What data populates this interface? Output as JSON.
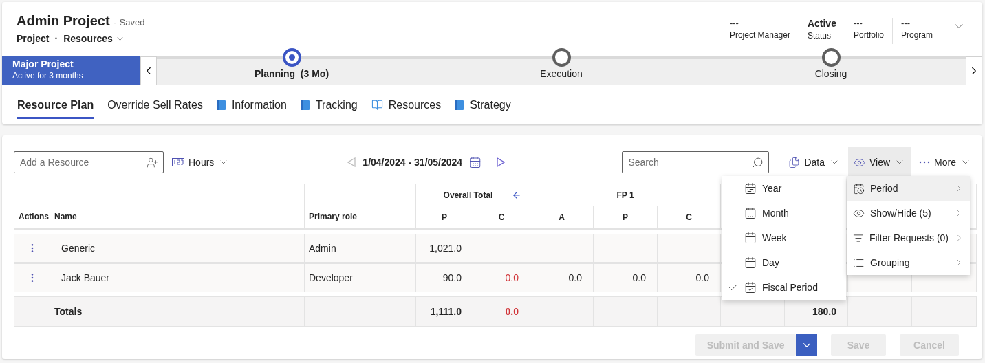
{
  "header": {
    "title": "Admin Project",
    "save_status": "- Saved",
    "separator": "·",
    "breadcrumb": [
      {
        "label": "Project",
        "dropdown": false
      },
      {
        "label": "Resources",
        "dropdown": true
      }
    ],
    "fields": [
      {
        "value": "---",
        "label": "Project Manager",
        "emphasis": false
      },
      {
        "value": "Active",
        "label": "Status",
        "emphasis": true
      },
      {
        "value": "---",
        "label": "Portfolio",
        "emphasis": false
      },
      {
        "value": "---",
        "label": "Program",
        "emphasis": false
      }
    ]
  },
  "process": {
    "name": "Major Project",
    "duration": "Active for 3 months",
    "stages": [
      {
        "label": "Planning",
        "duration": "(3 Mo)",
        "selected": true
      },
      {
        "label": "Execution",
        "selected": false
      },
      {
        "label": "Closing",
        "selected": false
      }
    ]
  },
  "tabs": [
    {
      "label": "Resource Plan",
      "kind": "plain",
      "selected": true
    },
    {
      "label": "Override Sell Rates",
      "kind": "plain",
      "selected": false
    },
    {
      "label": "Information",
      "kind": "book",
      "selected": false
    },
    {
      "label": "Tracking",
      "kind": "book",
      "selected": false
    },
    {
      "label": "Resources",
      "kind": "open-book",
      "selected": false
    },
    {
      "label": "Strategy",
      "kind": "book",
      "selected": false
    }
  ],
  "toolbar": {
    "resource_field": {
      "placeholder": "Add a Resource"
    },
    "unit": "Hours",
    "date_range": "1/04/2024 - 31/05/2024",
    "prev_enabled": false,
    "next_enabled": true,
    "search": {
      "placeholder": "Search"
    },
    "actions": [
      {
        "label": "Data",
        "selected": false
      },
      {
        "label": "View",
        "selected": true
      },
      {
        "label": "More",
        "selected": false
      }
    ]
  },
  "table": {
    "fixed_columns": [
      "Actions",
      "Name",
      "Primary role"
    ],
    "groups": [
      {
        "label": "Overall Total",
        "collapsible": true,
        "columns": [
          "P",
          "C"
        ]
      },
      {
        "label": "FP 1",
        "collapsible": false,
        "columns": [
          "A",
          "P",
          "C"
        ]
      }
    ],
    "rows": [
      {
        "name": "Generic",
        "role": "Admin",
        "cells": [
          {
            "text": "1,021.0",
            "alert": false
          }
        ]
      },
      {
        "name": "Jack Bauer",
        "role": "Developer",
        "cells": [
          {
            "text": "90.0",
            "alert": false
          },
          {
            "text": "0.0",
            "alert": true
          },
          {
            "text": "0.0",
            "alert": false
          },
          {
            "text": "0.0",
            "alert": false
          },
          {
            "text": "0.0",
            "alert": false
          }
        ]
      }
    ],
    "totals": {
      "label": "Totals",
      "cells": [
        {
          "text": "1,111.0",
          "alert": false
        },
        {
          "text": "0.0",
          "alert": true
        }
      ],
      "column_10": "180.0"
    }
  },
  "view_menu": {
    "items": [
      {
        "label": "Period",
        "selected": true
      },
      {
        "label": "Show/Hide (5)",
        "selected": false
      },
      {
        "label": "Filter Requests (0)",
        "selected": false
      },
      {
        "label": "Grouping",
        "selected": false
      }
    ]
  },
  "period_menu": {
    "items": [
      {
        "label": "Year",
        "checked": false
      },
      {
        "label": "Month",
        "checked": false
      },
      {
        "label": "Week",
        "checked": false
      },
      {
        "label": "Day",
        "checked": false
      },
      {
        "label": "Fiscal Period",
        "checked": true
      }
    ]
  },
  "buttons": [
    {
      "label": "Submit and Save",
      "disabled": true,
      "split": true
    },
    {
      "label": "Save",
      "disabled": true,
      "split": false
    },
    {
      "label": "Cancel",
      "disabled": true,
      "split": false
    }
  ]
}
